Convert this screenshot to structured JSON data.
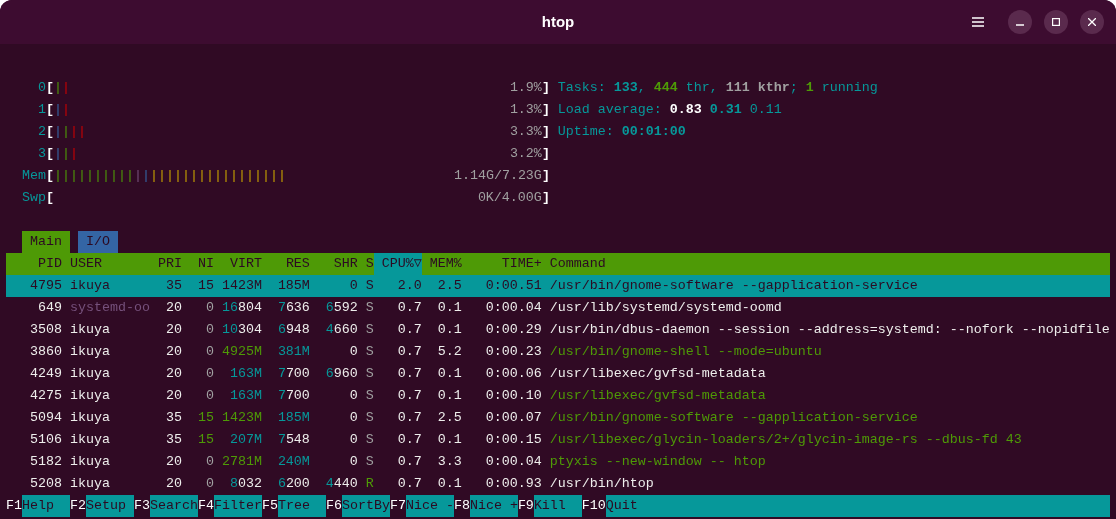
{
  "window": {
    "title": "htop"
  },
  "meters": [
    {
      "label": "0",
      "open": "[",
      "bars": [
        {
          "text": "|",
          "kind": "normal"
        },
        {
          "text": "|",
          "kind": "kernel"
        }
      ],
      "value": "1.9%",
      "close": "]"
    },
    {
      "label": "1",
      "open": "[",
      "bars": [
        {
          "text": "|",
          "kind": "low"
        },
        {
          "text": "|",
          "kind": "kernel"
        }
      ],
      "value": "1.3%",
      "close": "]"
    },
    {
      "label": "2",
      "open": "[",
      "bars": [
        {
          "text": "|",
          "kind": "low"
        },
        {
          "text": "|",
          "kind": "normal"
        },
        {
          "text": "||",
          "kind": "kernel"
        }
      ],
      "value": "3.3%",
      "close": "]"
    },
    {
      "label": "3",
      "open": "[",
      "bars": [
        {
          "text": "|",
          "kind": "low"
        },
        {
          "text": "|",
          "kind": "normal"
        },
        {
          "text": "|",
          "kind": "kernel"
        }
      ],
      "value": "3.2%",
      "close": "]"
    },
    {
      "label": "Mem",
      "open": "[",
      "bars": [
        {
          "text": "||||||||||",
          "kind": "used"
        },
        {
          "text": "|",
          "kind": "shared"
        },
        {
          "text": "|",
          "kind": "buffers"
        },
        {
          "text": "|||||||||||||||||",
          "kind": "cache"
        }
      ],
      "value": "1.14G/7.23G",
      "close": "]"
    },
    {
      "label": "Swp",
      "open": "[",
      "value": "0K/4.00G",
      "close": "]"
    }
  ],
  "summary": [
    [
      {
        "text": "Tasks: ",
        "kind": "label"
      },
      {
        "text": "133",
        "kind": "value"
      },
      {
        "text": ", ",
        "kind": "label"
      },
      {
        "text": "444",
        "kind": "accent"
      },
      {
        "text": " thr, ",
        "kind": "label"
      },
      {
        "text": "111 kthr",
        "kind": "muted"
      },
      {
        "text": "; ",
        "kind": "label"
      },
      {
        "text": "1",
        "kind": "accent"
      },
      {
        "text": " running",
        "kind": "label"
      }
    ],
    [
      {
        "text": "Load average: ",
        "kind": "label"
      },
      {
        "text": "0.83 ",
        "kind": "highlight"
      },
      {
        "text": "0.31 ",
        "kind": "value"
      },
      {
        "text": "0.11",
        "kind": "label"
      }
    ],
    [
      {
        "text": "Uptime: ",
        "kind": "label"
      },
      {
        "text": "00:01:00",
        "kind": "value"
      }
    ]
  ],
  "tabs": [
    {
      "label": "Main",
      "selected": true
    },
    {
      "label": "I/O",
      "selected": false
    }
  ],
  "columns": [
    {
      "label": "PID",
      "sorted": false
    },
    {
      "label": "USER",
      "sorted": false
    },
    {
      "label": "PRI",
      "sorted": false
    },
    {
      "label": "NI",
      "sorted": false
    },
    {
      "label": "VIRT",
      "sorted": false
    },
    {
      "label": "RES",
      "sorted": false
    },
    {
      "label": "SHR",
      "sorted": false
    },
    {
      "label": "S",
      "sorted": false
    },
    {
      "label": "CPU%▽",
      "sorted": true
    },
    {
      "label": "MEM%",
      "sorted": false
    },
    {
      "label": "TIME+",
      "sorted": false
    },
    {
      "label": "Command",
      "sorted": false
    }
  ],
  "processes": [
    {
      "selected": true,
      "cells": [
        "4795",
        "ikuya",
        "35",
        "15",
        "1423M",
        "185M",
        "0",
        "S",
        "2.0",
        "2.5",
        "0:00.51",
        "/usr/bin/gnome-software --gapplication-service"
      ]
    },
    {
      "selected": false,
      "cells": [
        "649",
        [
          {
            "text": "systemd-oo",
            "kind": "system"
          }
        ],
        "20",
        [
          {
            "text": "0",
            "kind": "dim"
          }
        ],
        [
          {
            "text": "16",
            "kind": "magnitude"
          },
          {
            "text": "804",
            "kind": "normal"
          }
        ],
        [
          {
            "text": "7",
            "kind": "magnitude"
          },
          {
            "text": "636",
            "kind": "normal"
          }
        ],
        [
          {
            "text": "6",
            "kind": "magnitude"
          },
          {
            "text": "592",
            "kind": "normal"
          }
        ],
        [
          {
            "text": "S",
            "kind": "dim"
          }
        ],
        "0.7",
        "0.1",
        "0:00.04",
        "/usr/lib/systemd/systemd-oomd"
      ]
    },
    {
      "selected": false,
      "cells": [
        "3508",
        "ikuya",
        "20",
        [
          {
            "text": "0",
            "kind": "dim"
          }
        ],
        [
          {
            "text": "10",
            "kind": "magnitude"
          },
          {
            "text": "304",
            "kind": "normal"
          }
        ],
        [
          {
            "text": "6",
            "kind": "magnitude"
          },
          {
            "text": "948",
            "kind": "normal"
          }
        ],
        [
          {
            "text": "4",
            "kind": "magnitude"
          },
          {
            "text": "660",
            "kind": "normal"
          }
        ],
        [
          {
            "text": "S",
            "kind": "dim"
          }
        ],
        "0.7",
        "0.1",
        "0:00.29",
        "/usr/bin/dbus-daemon --session --address=systemd: --nofork --nopidfile"
      ]
    },
    {
      "selected": false,
      "cells": [
        "3860",
        "ikuya",
        "20",
        [
          {
            "text": "0",
            "kind": "dim"
          }
        ],
        [
          {
            "text": "4925M",
            "kind": "large"
          }
        ],
        [
          {
            "text": "381M",
            "kind": "magnitude"
          }
        ],
        "0",
        [
          {
            "text": "S",
            "kind": "dim"
          }
        ],
        "0.7",
        "5.2",
        "0:00.23",
        [
          {
            "text": "/usr/bin/gnome-shell --mode=ubuntu",
            "kind": "thread"
          }
        ]
      ]
    },
    {
      "selected": false,
      "cells": [
        "4249",
        "ikuya",
        "20",
        [
          {
            "text": "0",
            "kind": "dim"
          }
        ],
        [
          {
            "text": "163M",
            "kind": "magnitude"
          }
        ],
        [
          {
            "text": "7",
            "kind": "magnitude"
          },
          {
            "text": "700",
            "kind": "normal"
          }
        ],
        [
          {
            "text": "6",
            "kind": "magnitude"
          },
          {
            "text": "960",
            "kind": "normal"
          }
        ],
        [
          {
            "text": "S",
            "kind": "dim"
          }
        ],
        "0.7",
        "0.1",
        "0:00.06",
        "/usr/libexec/gvfsd-metadata"
      ]
    },
    {
      "selected": false,
      "cells": [
        "4275",
        "ikuya",
        "20",
        [
          {
            "text": "0",
            "kind": "dim"
          }
        ],
        [
          {
            "text": "163M",
            "kind": "magnitude"
          }
        ],
        [
          {
            "text": "7",
            "kind": "magnitude"
          },
          {
            "text": "700",
            "kind": "normal"
          }
        ],
        "0",
        [
          {
            "text": "S",
            "kind": "dim"
          }
        ],
        "0.7",
        "0.1",
        "0:00.10",
        [
          {
            "text": "/usr/libexec/gvfsd-metadata",
            "kind": "thread"
          }
        ]
      ]
    },
    {
      "selected": false,
      "cells": [
        "5094",
        "ikuya",
        "35",
        [
          {
            "text": "15",
            "kind": "large"
          }
        ],
        [
          {
            "text": "1423M",
            "kind": "large"
          }
        ],
        [
          {
            "text": "185M",
            "kind": "magnitude"
          }
        ],
        "0",
        [
          {
            "text": "S",
            "kind": "dim"
          }
        ],
        "0.7",
        "2.5",
        "0:00.07",
        [
          {
            "text": "/usr/bin/gnome-software --gapplication-service",
            "kind": "thread"
          }
        ]
      ]
    },
    {
      "selected": false,
      "cells": [
        "5106",
        "ikuya",
        "35",
        [
          {
            "text": "15",
            "kind": "large"
          }
        ],
        [
          {
            "text": "207M",
            "kind": "magnitude"
          }
        ],
        [
          {
            "text": "7",
            "kind": "magnitude"
          },
          {
            "text": "548",
            "kind": "normal"
          }
        ],
        "0",
        [
          {
            "text": "S",
            "kind": "dim"
          }
        ],
        "0.7",
        "0.1",
        "0:00.15",
        [
          {
            "text": "/usr/libexec/glycin-loaders/2+/glycin-image-rs --dbus-fd 43",
            "kind": "thread"
          }
        ]
      ]
    },
    {
      "selected": false,
      "cells": [
        "5182",
        "ikuya",
        "20",
        [
          {
            "text": "0",
            "kind": "dim"
          }
        ],
        [
          {
            "text": "2781M",
            "kind": "large"
          }
        ],
        [
          {
            "text": "240M",
            "kind": "magnitude"
          }
        ],
        "0",
        [
          {
            "text": "S",
            "kind": "dim"
          }
        ],
        "0.7",
        "3.3",
        "0:00.04",
        [
          {
            "text": "ptyxis --new-window -- htop",
            "kind": "thread"
          }
        ]
      ]
    },
    {
      "selected": false,
      "cells": [
        "5208",
        "ikuya",
        "20",
        [
          {
            "text": "0",
            "kind": "dim"
          }
        ],
        [
          {
            "text": "8",
            "kind": "magnitude"
          },
          {
            "text": "032",
            "kind": "normal"
          }
        ],
        [
          {
            "text": "6",
            "kind": "magnitude"
          },
          {
            "text": "200",
            "kind": "normal"
          }
        ],
        [
          {
            "text": "4",
            "kind": "magnitude"
          },
          {
            "text": "440",
            "kind": "normal"
          }
        ],
        [
          {
            "text": "R",
            "kind": "running"
          }
        ],
        "0.7",
        "0.1",
        "0:00.93",
        "/usr/bin/htop"
      ]
    }
  ],
  "function_keys": [
    {
      "key": "F1",
      "label": "Help"
    },
    {
      "key": "F2",
      "label": "Setup"
    },
    {
      "key": "F3",
      "label": "Search"
    },
    {
      "key": "F4",
      "label": "Filter"
    },
    {
      "key": "F5",
      "label": "Tree"
    },
    {
      "key": "F6",
      "label": "SortBy"
    },
    {
      "key": "F7",
      "label": "Nice -"
    },
    {
      "key": "F8",
      "label": "Nice +"
    },
    {
      "key": "F9",
      "label": "Kill"
    },
    {
      "key": "F10",
      "label": "Quit"
    }
  ]
}
